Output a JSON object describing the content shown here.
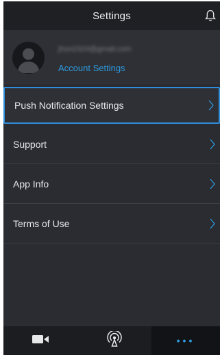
{
  "header": {
    "title": "Settings",
    "icon": "bell-icon"
  },
  "account": {
    "email": "jhun2324@gmail.com",
    "link_label": "Account Settings",
    "avatar_icon": "user-avatar-icon"
  },
  "menu": {
    "items": [
      {
        "label": "Push Notification Settings",
        "selected": true
      },
      {
        "label": "Support"
      },
      {
        "label": "App Info"
      },
      {
        "label": "Terms of Use"
      }
    ]
  },
  "tabbar": {
    "tabs": [
      {
        "icon": "video-camera-icon"
      },
      {
        "icon": "broadcast-icon"
      },
      {
        "icon": "more-dots-icon",
        "label": "•••",
        "active": true
      }
    ]
  },
  "colors": {
    "accent": "#2d9be0",
    "background": "#2b2c31",
    "header": "#1f2024"
  }
}
